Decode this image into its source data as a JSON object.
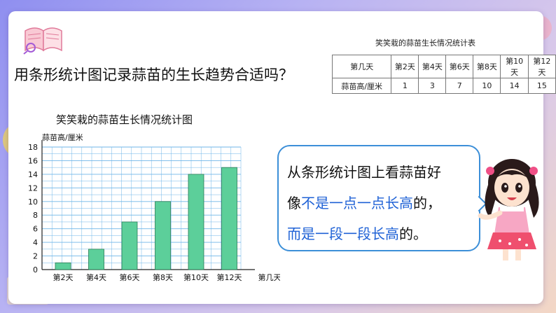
{
  "question": "用条形统计图记录蒜苗的生长趋势合适吗？",
  "table": {
    "title": "笑笑栽的蒜苗生长情况统计表",
    "row_header_day": "第几天",
    "row_header_height": "蒜苗高/厘米",
    "days": [
      "第2天",
      "第4天",
      "第6天",
      "第8天",
      "第10天",
      "第12天"
    ],
    "heights": [
      "1",
      "3",
      "7",
      "10",
      "14",
      "15"
    ]
  },
  "chart_data": {
    "type": "bar",
    "title": "笑笑栽的蒜苗生长情况统计图",
    "ylabel": "蒜苗高/厘米",
    "xlabel": "第几天",
    "categories": [
      "第2天",
      "第4天",
      "第6天",
      "第8天",
      "第10天",
      "第12天"
    ],
    "values": [
      1,
      3,
      7,
      10,
      14,
      15
    ],
    "ylim": [
      0,
      18
    ],
    "yticks": [
      0,
      2,
      4,
      6,
      8,
      10,
      12,
      14,
      16,
      18
    ],
    "grid": true,
    "bar_color": "#5ccf9a"
  },
  "bubble": {
    "line1": "从条形统计图上看蒜苗好",
    "line2_pre": "像",
    "line2_blue": "不是一点一点长高",
    "line2_post": "的，",
    "line3_blue": "而是一段一段长高",
    "line3_post": "的。",
    "highlight_color": "#1f62d6",
    "border_color": "#3c8fd8"
  },
  "icons": {
    "book": "open-book-magnifier-icon",
    "character": "cartoon-girl"
  }
}
